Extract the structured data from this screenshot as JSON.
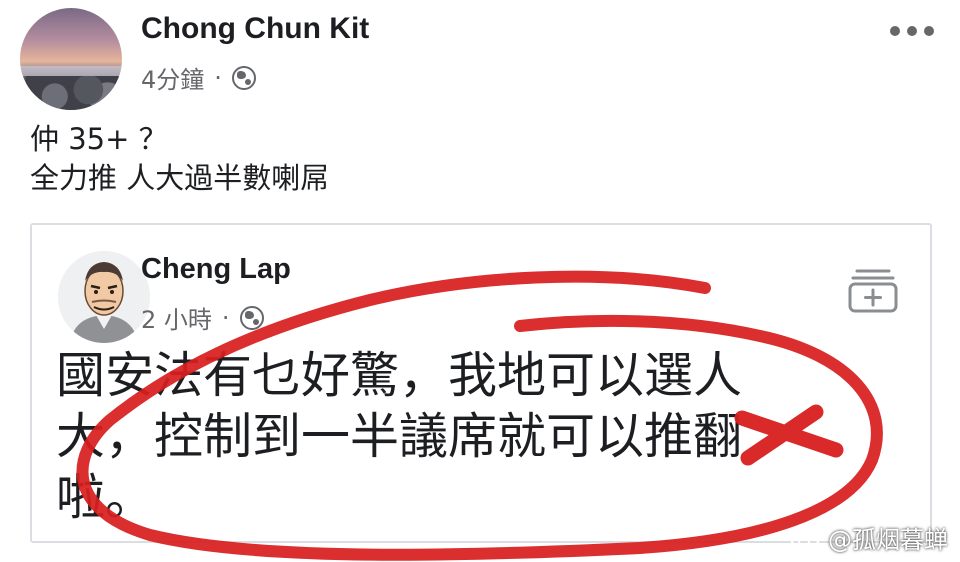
{
  "post": {
    "author": "Chong Chun Kit",
    "time": "4分鐘",
    "separator": "·",
    "privacy_icon": "globe-icon",
    "text_lines": [
      "仲 35+ ？",
      "全力推 人大過半數喇屌"
    ]
  },
  "shared_post": {
    "author": "Cheng Lap",
    "time": "2 小時",
    "separator": "·",
    "privacy_icon": "globe-icon",
    "save_icon": "save-post-icon",
    "text_lines": [
      "國安法有乜好驚，我地可以選人",
      "大，控制到一半議席就可以推翻",
      "啦。"
    ]
  },
  "annotation": {
    "type": "red-hand-drawn-circle-and-cross",
    "color": "#d81e1e"
  },
  "watermark": {
    "icon": "weibo-icon",
    "text": "@孤烟暮蝉"
  }
}
